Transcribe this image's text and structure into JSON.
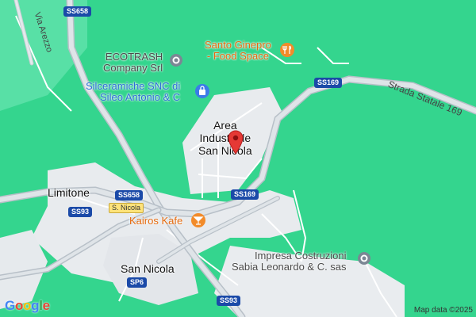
{
  "map": {
    "places": [
      {
        "id": "area",
        "text": "Area Industriale San Nicola"
      },
      {
        "id": "limitone",
        "text": "Limitone"
      },
      {
        "id": "sannicola",
        "text": "San Nicola"
      }
    ],
    "pois": {
      "ecotrash": "ECOTRASH Company Srl",
      "silceramiche": "Silceramiche SNC di Sileo Antonio & C",
      "santo": "Santo Ginepro - Food Space",
      "kairos": "Kairos Kafe",
      "impresa": "Impresa Costruzioni Sabia Leonardo & C. sas"
    },
    "roads": {
      "ss658_top": "SS658",
      "ss169_a": "SS169",
      "ss169_b": "SS169",
      "ss658_b": "SS658",
      "ss93_a": "SS93",
      "ss93_b": "SS93",
      "sp6": "SP6",
      "snicola": "S. Nicola",
      "via_arezzo": "Via Arezzo",
      "strada": "Strada Statale 169"
    },
    "area_line1": "Area",
    "area_line2": "Industriale",
    "area_line3": "San Nicola",
    "ecotrash_l1": "ECOTRASH",
    "ecotrash_l2": "Company Srl",
    "silc_l1": "Silceramiche SNC di",
    "silc_l2": "Sileo Antonio & C",
    "santo_l1": "Santo Ginepro",
    "santo_l2": "- Food Space",
    "impresa_l1": "Impresa Costruzioni",
    "impresa_l2": "Sabia Leonardo & C. sas"
  },
  "branding": {
    "logo": "Google",
    "attribution": "Map data ©2025"
  },
  "colors": {
    "forest": "#34d58e",
    "urban": "#e9ecef",
    "road": "#ffffff",
    "highway_shield": "#1b4aa8",
    "pin": "#e53935"
  }
}
